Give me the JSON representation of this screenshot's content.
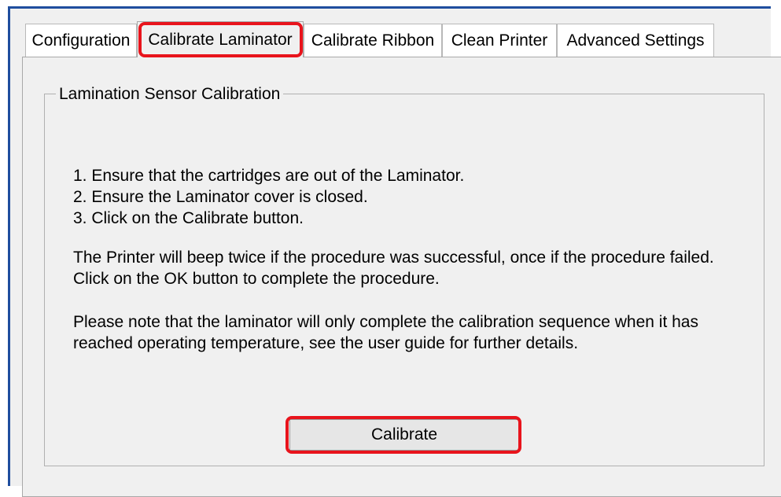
{
  "tabs": [
    {
      "label": "Configuration"
    },
    {
      "label": "Calibrate Laminator"
    },
    {
      "label": "Calibrate Ribbon"
    },
    {
      "label": "Clean Printer"
    },
    {
      "label": "Advanced Settings"
    }
  ],
  "active_tab": "Calibrate Laminator",
  "group": {
    "title": "Lamination Sensor Calibration",
    "steps": [
      "1. Ensure that the cartridges are out of the Laminator.",
      "2. Ensure the Laminator cover is closed.",
      "3. Click on the Calibrate button."
    ],
    "info": [
      "The Printer will beep twice if the procedure was successful, once if the procedure failed.",
      "Click on the OK button to complete the procedure."
    ],
    "note": [
      "Please note that the laminator will only complete the calibration sequence when it has",
      "reached operating temperature, see the user guide for further details."
    ],
    "calibrate_button": "Calibrate"
  },
  "colors": {
    "highlight": "#e8141c",
    "window_border": "#1f4e9e",
    "panel_bg": "#f0f0f0"
  }
}
